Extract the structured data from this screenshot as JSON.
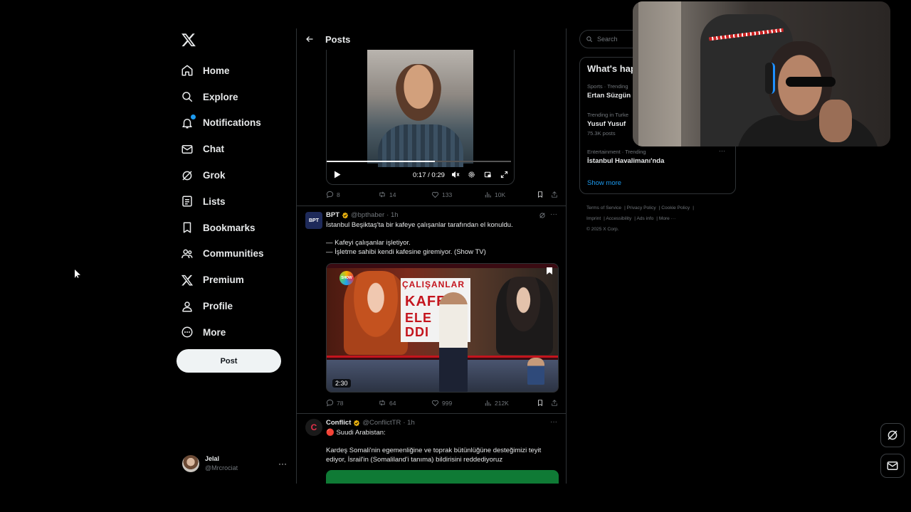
{
  "nav": {
    "items": [
      {
        "label": "Home",
        "icon": "home-icon"
      },
      {
        "label": "Explore",
        "icon": "search-icon"
      },
      {
        "label": "Notifications",
        "icon": "bell-icon",
        "badge": "1"
      },
      {
        "label": "Chat",
        "icon": "mail-icon"
      },
      {
        "label": "Grok",
        "icon": "grok-icon"
      },
      {
        "label": "Lists",
        "icon": "list-icon"
      },
      {
        "label": "Bookmarks",
        "icon": "bookmark-icon"
      },
      {
        "label": "Communities",
        "icon": "people-icon"
      },
      {
        "label": "Premium",
        "icon": "x-logo-icon"
      },
      {
        "label": "Profile",
        "icon": "person-icon"
      },
      {
        "label": "More",
        "icon": "more-circle-icon"
      }
    ],
    "post_label": "Post",
    "account": {
      "name": "Jelal",
      "handle": "@Mrcrociat"
    }
  },
  "header": {
    "title": "Posts"
  },
  "tweet1": {
    "video": {
      "time": "0:17 / 0:29",
      "progress": 0.586
    },
    "replies": "8",
    "reposts": "14",
    "likes": "133",
    "views": "10K"
  },
  "tweet2": {
    "name": "BPT",
    "handle": "@bpthaber",
    "time": "· 1h",
    "avatar_text": "BPT",
    "line1": "İstanbul Beşiktaş'ta bir kafeye çalışanlar tarafından el konuldu.",
    "line2": "— Kafeyi çalışanlar işletiyor.",
    "line3": "— İşletme sahibi kendi kafesine giremiyor. (Show TV)",
    "video": {
      "duration": "2:30",
      "logo": "SHOW",
      "board_l1": "ÇALIŞANLAR",
      "board_l2": "KAFE",
      "board_l3": "ELE",
      "board_l4": "DDI"
    },
    "replies": "78",
    "reposts": "64",
    "likes": "999",
    "views": "212K"
  },
  "tweet3": {
    "name": "Conflict",
    "handle": "@ConflictTR",
    "time": "· 1h",
    "avatar_text": "C",
    "line1": "🔴 Suudi Arabistan:",
    "line2": "Kardeş Somali'nin egemenliğine ve toprak bütünlüğüne desteğimizi teyit ediyor, İsrail'in (Somaliland'i tanıma) bildirisini reddediyoruz"
  },
  "sidebar": {
    "search_placeholder": "Search",
    "trends_title": "What's hap",
    "trends": [
      {
        "meta": "Sports · Trending",
        "name": "Ertan Süzgün",
        "count": ""
      },
      {
        "meta": "Trending in Turke",
        "name": "Yusuf Yusuf",
        "count": "75.3K posts"
      },
      {
        "meta": "Entertainment · Trending",
        "name": "İstanbul Havalimanı'nda",
        "count": ""
      }
    ],
    "show_more": "Show more",
    "footer": {
      "tos": "Terms of Service",
      "privacy": "Privacy Policy",
      "cookie": "Cookie Policy",
      "imprint": "Imprint",
      "accessibility": "Accessibility",
      "ads": "Ads info",
      "more": "More ···",
      "copyright": "© 2025 X Corp."
    }
  },
  "colors": {
    "accent": "#1d9bf0",
    "background": "#000000",
    "border": "#2f3336",
    "muted": "#71767b",
    "text": "#e7e9ea",
    "verified": "#e8b00f"
  }
}
